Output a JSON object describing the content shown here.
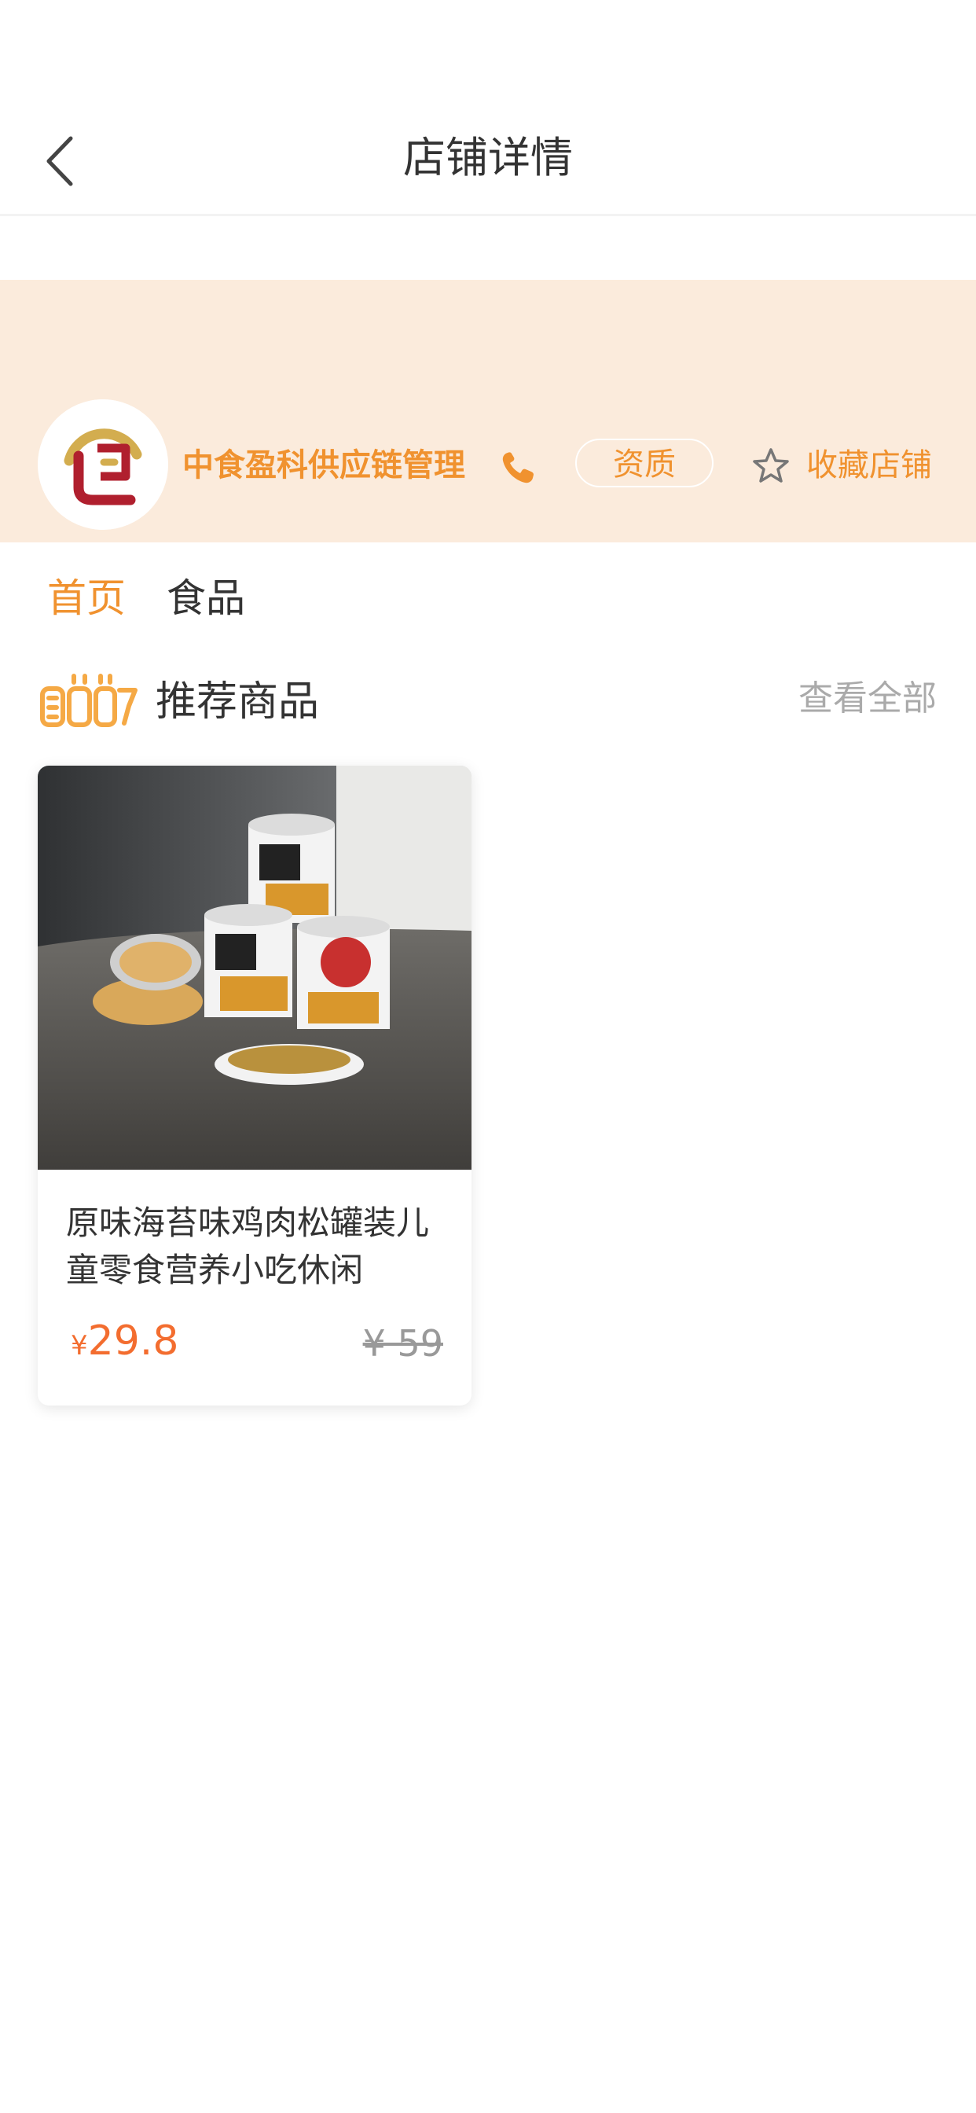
{
  "nav": {
    "title": "店铺详情"
  },
  "shop": {
    "name": "中食盈科供应链管理",
    "qualification_label": "资质",
    "favorite_label": "收藏店铺"
  },
  "tabs": [
    {
      "label": "首页",
      "active": true
    },
    {
      "label": "食品",
      "active": false
    }
  ],
  "section": {
    "title": "推荐商品",
    "view_all": "查看全部"
  },
  "products": [
    {
      "name": "原味海苔味鸡肉松罐装儿童零食营养小吃休闲",
      "currency": "¥",
      "price": "29.8",
      "original_price": "¥ 59"
    }
  ],
  "colors": {
    "accent": "#f0922f",
    "price": "#f36d2f",
    "banner_bg": "#fbebdc",
    "text": "#333333",
    "muted": "#aaaaaa"
  },
  "icons": [
    "back-arrow-icon",
    "shop-logo",
    "phone-icon",
    "star-outline-icon",
    "recommend-icon"
  ]
}
